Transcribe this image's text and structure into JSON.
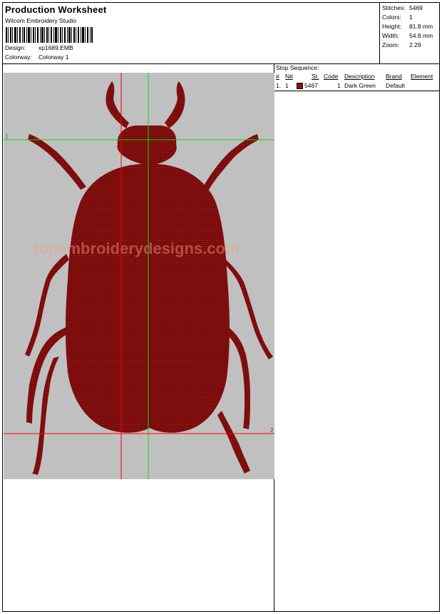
{
  "header": {
    "title": "Production Worksheet",
    "company": "Wilcom Embroidery Studio",
    "design_label": "Design:",
    "design_value": "xp1689.EMB",
    "colorway_label": "Colorway:",
    "colorway_value": "Colorway 1"
  },
  "stats": [
    {
      "label": "Stitches:",
      "value": "5469"
    },
    {
      "label": "Colors:",
      "value": "1"
    },
    {
      "label": "Height:",
      "value": "81.8 mm"
    },
    {
      "label": "Width:",
      "value": "54.8 mm"
    },
    {
      "label": "Zoom:",
      "value": "2.29"
    }
  ],
  "stop_sequence": {
    "title": "Stop Sequence:",
    "columns": {
      "num": "#",
      "nnum": "N#",
      "st": "St.",
      "code": "Code",
      "description": "Description",
      "brand": "Brand",
      "element": "Element"
    },
    "rows": [
      {
        "num": "1.",
        "nnum": "1",
        "st": "5467",
        "code": "1",
        "description": "Dark Green",
        "brand": "Default",
        "color": "#8b1010"
      }
    ]
  },
  "design": {
    "background_color": "#c0c0c0",
    "thread_color": "#8b1010",
    "guide_green": "#00e000",
    "guide_red": "#ff0000",
    "marker_1": "1",
    "marker_2": "2",
    "watermark": "topembroiderydesigns.com"
  }
}
